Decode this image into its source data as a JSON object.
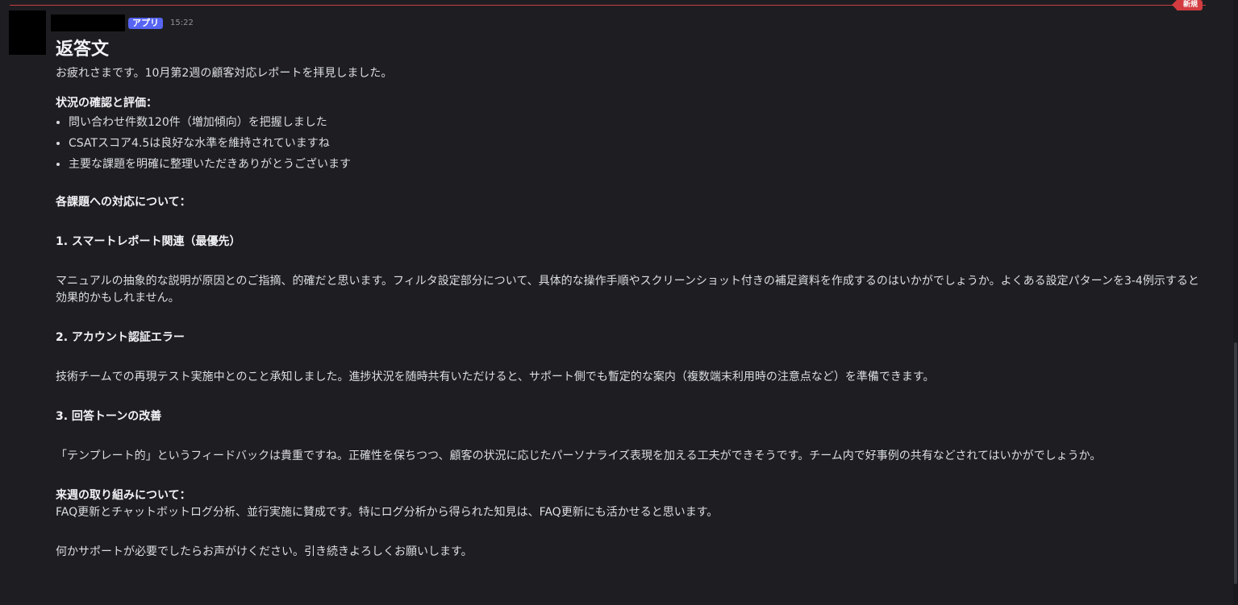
{
  "new_divider": {
    "label": "新規"
  },
  "message": {
    "app_badge": "アプリ",
    "timestamp": "15:22",
    "title": "返答文",
    "greeting": "お疲れさまです。10月第2週の顧客対応レポートを拝見しました。",
    "status_heading": "状況の確認と評価：",
    "status_items": [
      "問い合わせ件数120件（増加傾向）を把握しました",
      "CSATスコア4.5は良好な水準を維持されていますね",
      "主要な課題を明確に整理いただきありがとうございます"
    ],
    "issues_heading": "各課題への対応について：",
    "issue1_heading": "1. スマートレポート関連（最優先）",
    "issue1_body": "マニュアルの抽象的な説明が原因とのご指摘、的確だと思います。フィルタ設定部分について、具体的な操作手順やスクリーンショット付きの補足資料を作成するのはいかがでしょうか。よくある設定パターンを3-4例示すると効果的かもしれません。",
    "issue2_heading": "2. アカウント認証エラー",
    "issue2_body": "技術チームでの再現テスト実施中とのこと承知しました。進捗状況を随時共有いただけると、サポート側でも暫定的な案内（複数端末利用時の注意点など）を準備できます。",
    "issue3_heading": "3. 回答トーンの改善",
    "issue3_body": "「テンプレート的」というフィードバックは貴重ですね。正確性を保ちつつ、顧客の状況に応じたパーソナライズ表現を加える工夫ができそうです。チーム内で好事例の共有などされてはいかがでしょうか。",
    "next_week_heading": "来週の取り組みについて：",
    "next_week_body": "FAQ更新とチャットボットログ分析、並行実施に賛成です。特にログ分析から得られた知見は、FAQ更新にも活かせると思います。",
    "closing": "何かサポートが必要でしたらお声がけください。引き続きよろしくお願いします。"
  },
  "colors": {
    "background": "#1e1e22",
    "text": "#dbdee1",
    "badge": "#5865f2",
    "new_divider": "#d23c40"
  }
}
